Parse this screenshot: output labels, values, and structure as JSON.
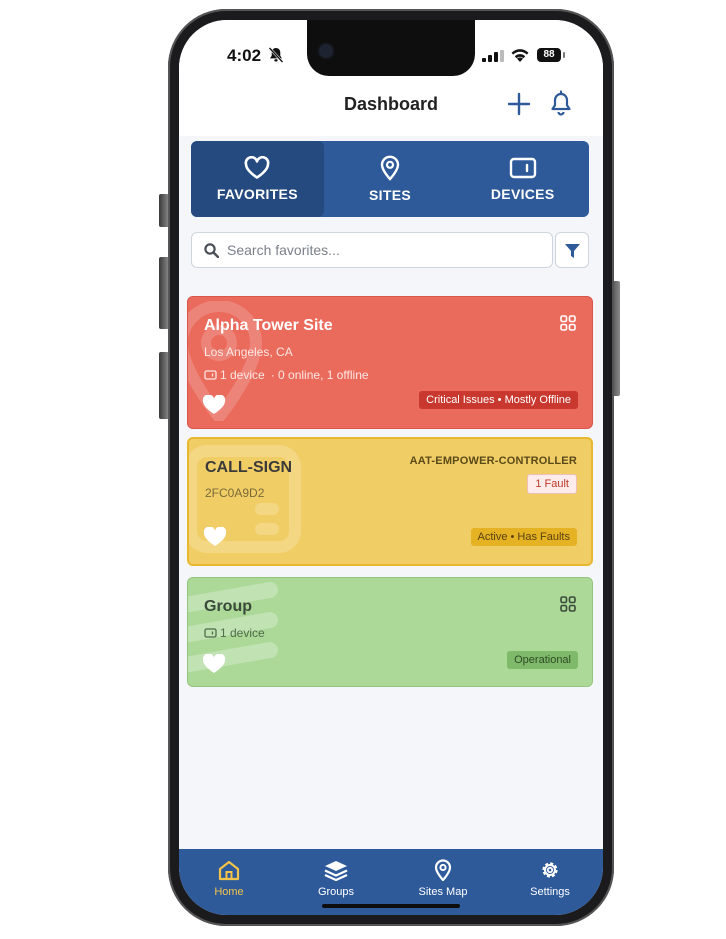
{
  "status_bar": {
    "time": "4:02",
    "battery": "88"
  },
  "header": {
    "title": "Dashboard"
  },
  "tabs": [
    {
      "label": "FAVORITES",
      "icon": "heart-outline-icon",
      "active": true
    },
    {
      "label": "SITES",
      "icon": "map-pin-icon",
      "active": false
    },
    {
      "label": "DEVICES",
      "icon": "device-icon",
      "active": false
    }
  ],
  "search": {
    "placeholder": "Search favorites..."
  },
  "cards": [
    {
      "title": "Alpha Tower Site",
      "location": "Los Angeles, CA",
      "device_count": "1 device",
      "online_info": "· 0 online, 1 offline",
      "status": "Critical Issues • Mostly Offline",
      "color": "#ea6a5c"
    },
    {
      "title": "CALL-SIGN",
      "serial": "2FC0A9D2",
      "model": "AAT-EMPOWER-CONTROLLER",
      "fault": "1 Fault",
      "status": "Active • Has Faults",
      "color": "#f1cd65"
    },
    {
      "title": "Group",
      "device_count": "1 device",
      "status": "Operational",
      "color": "#acd898"
    }
  ],
  "bottom_nav": [
    {
      "label": "Home",
      "icon": "home-icon",
      "active": true
    },
    {
      "label": "Groups",
      "icon": "layers-icon",
      "active": false
    },
    {
      "label": "Sites Map",
      "icon": "map-pin-icon",
      "active": false
    },
    {
      "label": "Settings",
      "icon": "gear-icon",
      "active": false
    }
  ],
  "colors": {
    "primary": "#2e5a9a",
    "active_nav": "#f3c34a",
    "critical": "#ea6a5c",
    "warning": "#f1cd65",
    "ok": "#acd898"
  }
}
